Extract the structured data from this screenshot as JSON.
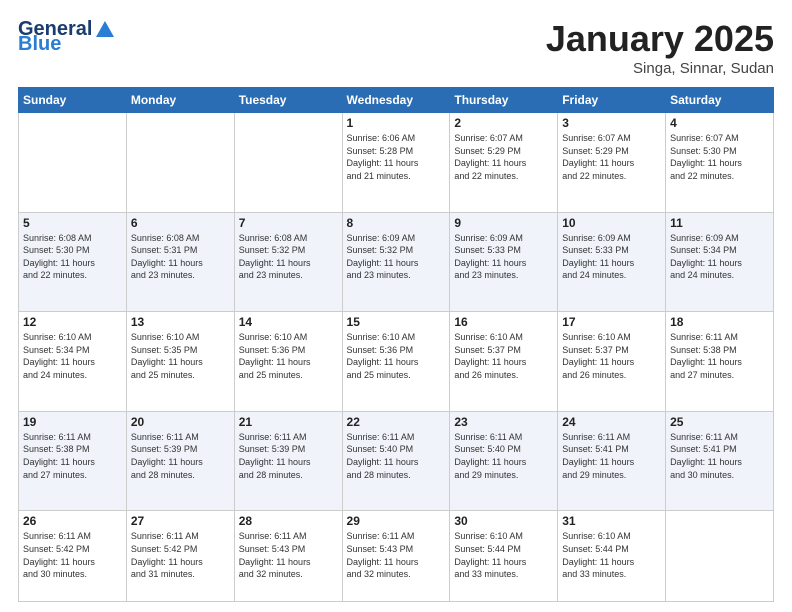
{
  "logo": {
    "text_general": "General",
    "text_blue": "Blue",
    "tagline": ""
  },
  "header": {
    "month": "January 2025",
    "location": "Singa, Sinnar, Sudan"
  },
  "weekdays": [
    "Sunday",
    "Monday",
    "Tuesday",
    "Wednesday",
    "Thursday",
    "Friday",
    "Saturday"
  ],
  "weeks": [
    [
      {
        "day": "",
        "info": ""
      },
      {
        "day": "",
        "info": ""
      },
      {
        "day": "",
        "info": ""
      },
      {
        "day": "1",
        "info": "Sunrise: 6:06 AM\nSunset: 5:28 PM\nDaylight: 11 hours\nand 21 minutes."
      },
      {
        "day": "2",
        "info": "Sunrise: 6:07 AM\nSunset: 5:29 PM\nDaylight: 11 hours\nand 22 minutes."
      },
      {
        "day": "3",
        "info": "Sunrise: 6:07 AM\nSunset: 5:29 PM\nDaylight: 11 hours\nand 22 minutes."
      },
      {
        "day": "4",
        "info": "Sunrise: 6:07 AM\nSunset: 5:30 PM\nDaylight: 11 hours\nand 22 minutes."
      }
    ],
    [
      {
        "day": "5",
        "info": "Sunrise: 6:08 AM\nSunset: 5:30 PM\nDaylight: 11 hours\nand 22 minutes."
      },
      {
        "day": "6",
        "info": "Sunrise: 6:08 AM\nSunset: 5:31 PM\nDaylight: 11 hours\nand 23 minutes."
      },
      {
        "day": "7",
        "info": "Sunrise: 6:08 AM\nSunset: 5:32 PM\nDaylight: 11 hours\nand 23 minutes."
      },
      {
        "day": "8",
        "info": "Sunrise: 6:09 AM\nSunset: 5:32 PM\nDaylight: 11 hours\nand 23 minutes."
      },
      {
        "day": "9",
        "info": "Sunrise: 6:09 AM\nSunset: 5:33 PM\nDaylight: 11 hours\nand 23 minutes."
      },
      {
        "day": "10",
        "info": "Sunrise: 6:09 AM\nSunset: 5:33 PM\nDaylight: 11 hours\nand 24 minutes."
      },
      {
        "day": "11",
        "info": "Sunrise: 6:09 AM\nSunset: 5:34 PM\nDaylight: 11 hours\nand 24 minutes."
      }
    ],
    [
      {
        "day": "12",
        "info": "Sunrise: 6:10 AM\nSunset: 5:34 PM\nDaylight: 11 hours\nand 24 minutes."
      },
      {
        "day": "13",
        "info": "Sunrise: 6:10 AM\nSunset: 5:35 PM\nDaylight: 11 hours\nand 25 minutes."
      },
      {
        "day": "14",
        "info": "Sunrise: 6:10 AM\nSunset: 5:36 PM\nDaylight: 11 hours\nand 25 minutes."
      },
      {
        "day": "15",
        "info": "Sunrise: 6:10 AM\nSunset: 5:36 PM\nDaylight: 11 hours\nand 25 minutes."
      },
      {
        "day": "16",
        "info": "Sunrise: 6:10 AM\nSunset: 5:37 PM\nDaylight: 11 hours\nand 26 minutes."
      },
      {
        "day": "17",
        "info": "Sunrise: 6:10 AM\nSunset: 5:37 PM\nDaylight: 11 hours\nand 26 minutes."
      },
      {
        "day": "18",
        "info": "Sunrise: 6:11 AM\nSunset: 5:38 PM\nDaylight: 11 hours\nand 27 minutes."
      }
    ],
    [
      {
        "day": "19",
        "info": "Sunrise: 6:11 AM\nSunset: 5:38 PM\nDaylight: 11 hours\nand 27 minutes."
      },
      {
        "day": "20",
        "info": "Sunrise: 6:11 AM\nSunset: 5:39 PM\nDaylight: 11 hours\nand 28 minutes."
      },
      {
        "day": "21",
        "info": "Sunrise: 6:11 AM\nSunset: 5:39 PM\nDaylight: 11 hours\nand 28 minutes."
      },
      {
        "day": "22",
        "info": "Sunrise: 6:11 AM\nSunset: 5:40 PM\nDaylight: 11 hours\nand 28 minutes."
      },
      {
        "day": "23",
        "info": "Sunrise: 6:11 AM\nSunset: 5:40 PM\nDaylight: 11 hours\nand 29 minutes."
      },
      {
        "day": "24",
        "info": "Sunrise: 6:11 AM\nSunset: 5:41 PM\nDaylight: 11 hours\nand 29 minutes."
      },
      {
        "day": "25",
        "info": "Sunrise: 6:11 AM\nSunset: 5:41 PM\nDaylight: 11 hours\nand 30 minutes."
      }
    ],
    [
      {
        "day": "26",
        "info": "Sunrise: 6:11 AM\nSunset: 5:42 PM\nDaylight: 11 hours\nand 30 minutes."
      },
      {
        "day": "27",
        "info": "Sunrise: 6:11 AM\nSunset: 5:42 PM\nDaylight: 11 hours\nand 31 minutes."
      },
      {
        "day": "28",
        "info": "Sunrise: 6:11 AM\nSunset: 5:43 PM\nDaylight: 11 hours\nand 32 minutes."
      },
      {
        "day": "29",
        "info": "Sunrise: 6:11 AM\nSunset: 5:43 PM\nDaylight: 11 hours\nand 32 minutes."
      },
      {
        "day": "30",
        "info": "Sunrise: 6:10 AM\nSunset: 5:44 PM\nDaylight: 11 hours\nand 33 minutes."
      },
      {
        "day": "31",
        "info": "Sunrise: 6:10 AM\nSunset: 5:44 PM\nDaylight: 11 hours\nand 33 minutes."
      },
      {
        "day": "",
        "info": ""
      }
    ]
  ]
}
